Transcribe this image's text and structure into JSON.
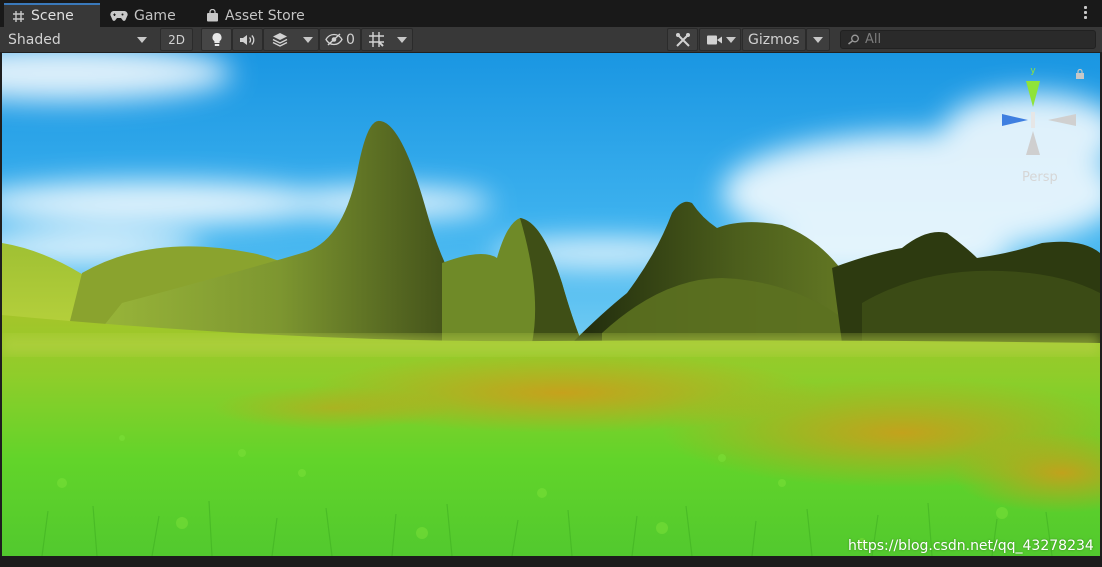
{
  "tabs": [
    {
      "label": "Scene",
      "icon": "scene-grid-icon",
      "active": true
    },
    {
      "label": "Game",
      "icon": "gamepad-icon",
      "active": false
    },
    {
      "label": "Asset Store",
      "icon": "store-bag-icon",
      "active": false
    }
  ],
  "toolbar": {
    "shading_mode": "Shaded",
    "mode_2d": "2D",
    "hidden_count": "0",
    "gizmos_label": "Gizmos",
    "search_placeholder": "All"
  },
  "viewport": {
    "projection_label": "Persp",
    "watermark": "https://blog.csdn.net/qq_43278234"
  },
  "colors": {
    "sky_top": "#1e9ce6",
    "grass_bright": "#6cd62a",
    "grass_orange": "#c8a215",
    "hills": "#7a9a2a",
    "gizmo_y": "#8fe33a",
    "gizmo_x": "#3f7fe0"
  }
}
